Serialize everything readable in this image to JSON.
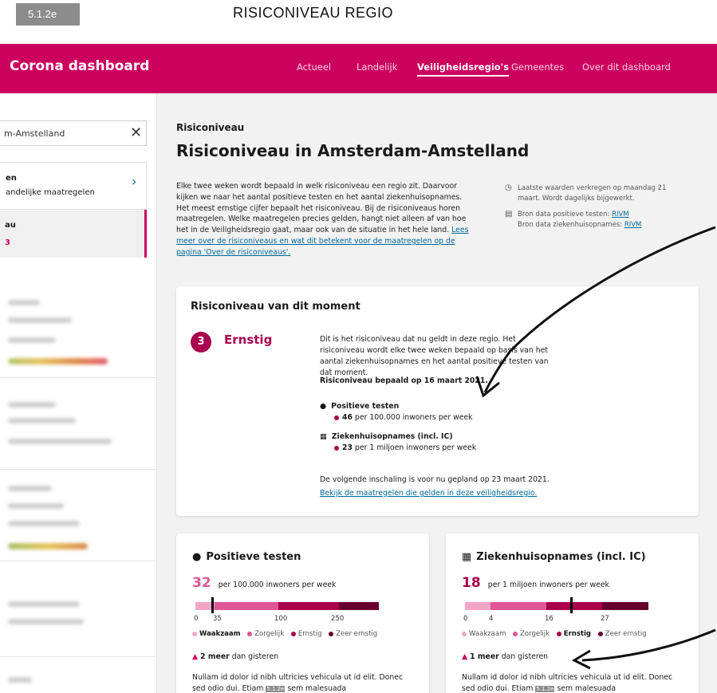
{
  "figure": {
    "tag": "5.1.2e",
    "title": "RISICONIVEAU REGIO"
  },
  "header": {
    "brand": "Corona dashboard",
    "nav": [
      "Actueel",
      "Landelijk",
      "Veiligheidsregio's",
      "Gemeentes",
      "Over dit dashboard"
    ],
    "active_nav": "Veiligheidsregio's"
  },
  "sidebar": {
    "search_value": "m-Amstelland",
    "item1_title": "en",
    "item1_sub": "andelijke maatregelen",
    "item2_title": "au",
    "item2_sub": "3"
  },
  "main": {
    "eyebrow": "Risiconiveau",
    "title": "Risiconiveau in Amsterdam-Amstelland",
    "intro": "Elke twee weken wordt bepaald in welk risiconiveau een regio zit. Daarvoor kijken we naar het aantal positieve testen en het aantal ziekenhuisopnames. Het meest ernstige cijfer bepaalt het risiconiveau. Bij de risiconiveaus horen maatregelen. Welke maatregelen precies gelden, hangt niet alleen af van hoe het in de Veiligheidsregio gaat, maar ook van de situatie in het hele land.",
    "intro_link": "Lees meer over de risiconiveaus en wat dit betekent voor de maatregelen op de pagina 'Over de risiconiveaus'.",
    "meta_update": "Laatste waarden verkregen op maandag 21 maart. Wordt dagelijks bijgewerkt.",
    "meta_source_tests_label": "Bron data positieve testen:",
    "meta_source_hosp_label": "Bron data ziekenhuisopnames:",
    "meta_source": "RIVM"
  },
  "risk": {
    "card_title": "Risiconiveau van dit moment",
    "level": "3",
    "level_name": "Ernstig",
    "description": "Dit is het risiconiveau dat nu geldt in deze regio. Het risiconiveau wordt elke twee weken bepaald op basis van het aantal ziekenhuisopnames en het aantal positieve testen van dat moment.",
    "determined": "Risiconiveau bepaald op 16 maart 2021.",
    "tests_label": "Positieve testen",
    "tests_value": "46",
    "tests_unit": "per 100.000 inwoners per week",
    "hosp_label": "Ziekenhuisopnames (incl. IC)",
    "hosp_value": "23",
    "hosp_unit": "per 1 miljoen inwoners per week",
    "next": "De volgende inschaling is voor nu gepland op 23 maart 2021.",
    "link": "Bekijk de maatregelen die gelden in deze veiligheidsregio."
  },
  "metrics": [
    {
      "title": "Positieve testen",
      "value": "32",
      "unit": "per 100.000 inwoners per week",
      "ticks": [
        "0",
        "35",
        "100",
        "250"
      ],
      "active_level": "Waakzaam",
      "change_num": "2 meer",
      "change_txt": "dan gisteren",
      "body": "Nullam id dolor id nibh ultricies vehicula ut id elit. Donec sed odio dui. Etiam",
      "body_tag": "5.1.2e",
      "body_end": "sem malesuada"
    },
    {
      "title": "Ziekenhuisopnames (incl. IC)",
      "value": "18",
      "unit": "per 1 miljoen inwoners per week",
      "ticks": [
        "0",
        "4",
        "16",
        "27"
      ],
      "active_level": "Ernstig",
      "change_num": "1 meer",
      "change_txt": "dan gisteren",
      "body": "Nullam id dolor id nibh ultricies vehicula ut id elit. Donec sed odio dui. Etiam",
      "body_tag": "5.1.2e",
      "body_end": "sem malesuada"
    }
  ],
  "levels": [
    "Waakzaam",
    "Zorgelijk",
    "Ernstig",
    "Zeer ernstig"
  ],
  "colors": {
    "brand": "#cc005f",
    "level_colors": [
      "#f3a6c6",
      "#e05596",
      "#a8004d",
      "#68002f"
    ],
    "link": "#01689b"
  }
}
